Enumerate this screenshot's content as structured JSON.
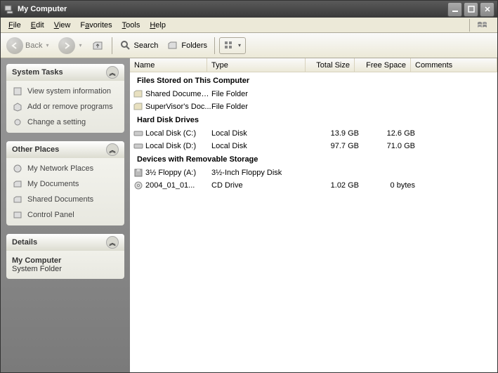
{
  "window": {
    "title": "My Computer"
  },
  "menu": {
    "file": "File",
    "edit": "Edit",
    "view": "View",
    "favorites": "Favorites",
    "tools": "Tools",
    "help": "Help"
  },
  "toolbar": {
    "back": "Back",
    "search": "Search",
    "folders": "Folders"
  },
  "columns": {
    "name": "Name",
    "type": "Type",
    "totalsize": "Total Size",
    "freespace": "Free Space",
    "comments": "Comments"
  },
  "groups": {
    "files": "Files Stored on This Computer",
    "hdd": "Hard Disk Drives",
    "removable": "Devices with Removable Storage"
  },
  "items": {
    "shared": {
      "name": "Shared Documents",
      "type": "File Folder"
    },
    "supervisor": {
      "name": "SuperVisor's Doc...",
      "type": "File Folder"
    },
    "cdrive": {
      "name": "Local Disk (C:)",
      "type": "Local Disk",
      "size": "13.9 GB",
      "free": "12.6 GB"
    },
    "ddrive": {
      "name": "Local Disk (D:)",
      "type": "Local Disk",
      "size": "97.7 GB",
      "free": "71.0 GB"
    },
    "floppy": {
      "name": "3½ Floppy (A:)",
      "type": "3½-Inch Floppy Disk"
    },
    "cd": {
      "name": "2004_01_01...",
      "type": "CD Drive",
      "size": "1.02 GB",
      "free": "0 bytes"
    }
  },
  "sidebar": {
    "systemtasks": {
      "title": "System Tasks",
      "viewinfo": "View system information",
      "addremove": "Add or remove programs",
      "changesetting": "Change a setting"
    },
    "otherplaces": {
      "title": "Other Places",
      "network": "My Network Places",
      "mydocs": "My Documents",
      "shared": "Shared Documents",
      "cpanel": "Control Panel"
    },
    "details": {
      "title": "Details",
      "name": "My Computer",
      "type": "System Folder"
    }
  }
}
